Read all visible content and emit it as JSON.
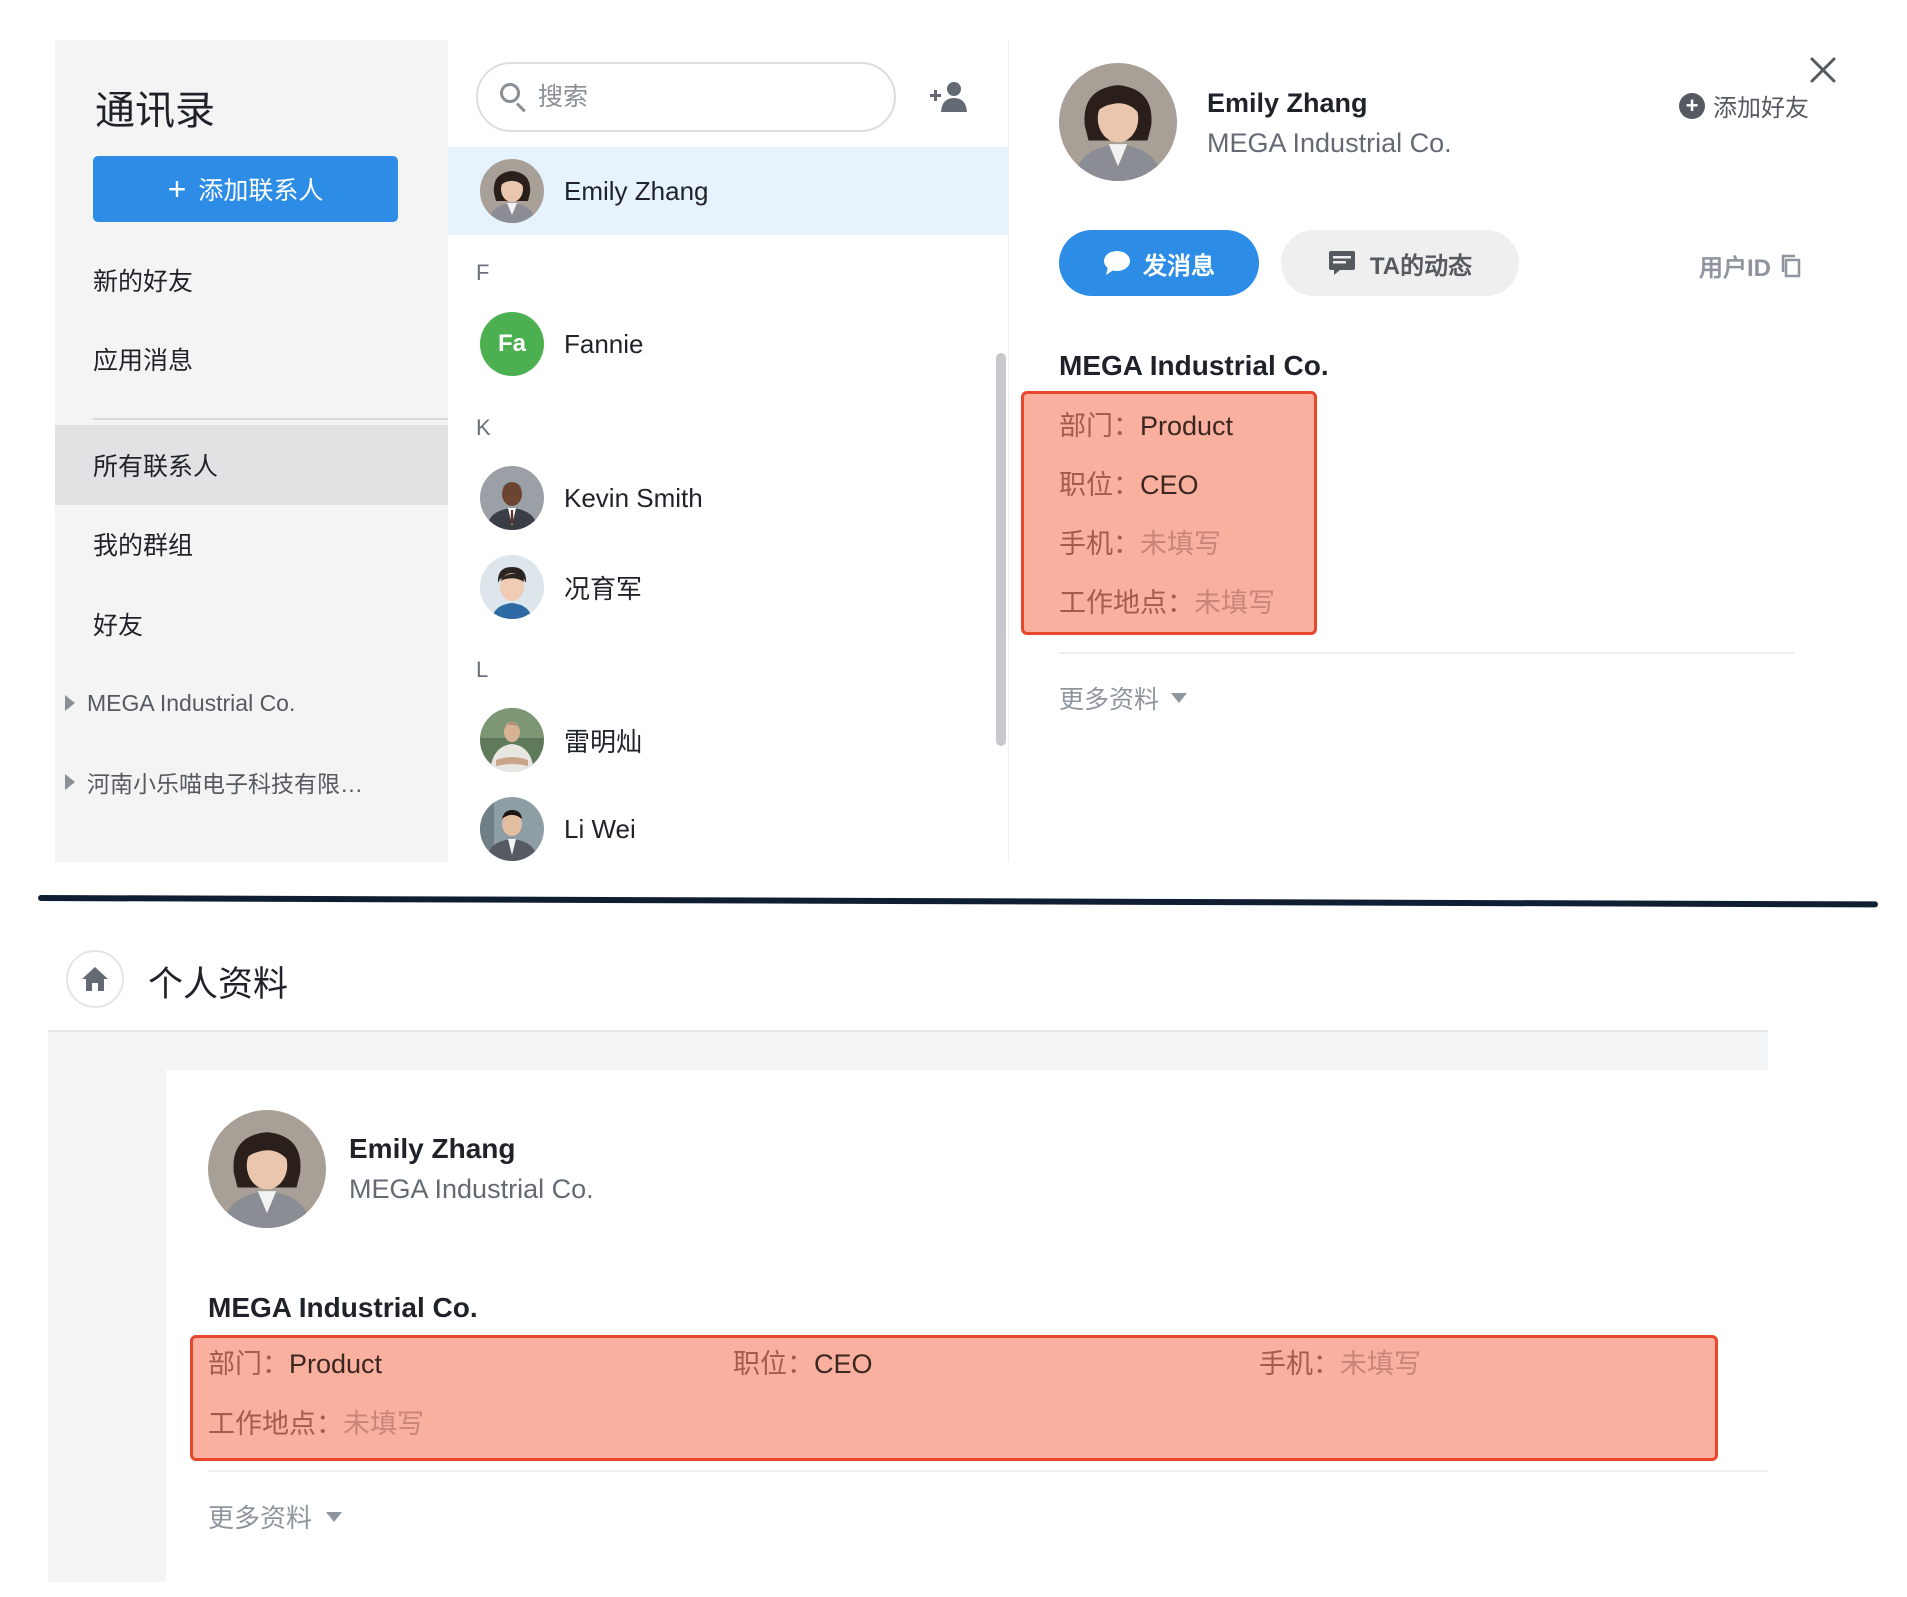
{
  "contacts_window": {
    "sidebar": {
      "title": "通讯录",
      "add_contact_label": "添加联系人",
      "items": [
        {
          "label": "新的好友"
        },
        {
          "label": "应用消息"
        },
        {
          "label": "所有联系人",
          "selected": true
        },
        {
          "label": "我的群组"
        },
        {
          "label": "好友"
        }
      ],
      "groups": [
        {
          "label": "MEGA Industrial Co."
        },
        {
          "label": "河南小乐喵电子科技有限…"
        }
      ]
    },
    "contact_list": {
      "search_placeholder": "搜索",
      "letters": {
        "f": "F",
        "k": "K",
        "l": "L"
      },
      "contacts": [
        {
          "name": "Emily Zhang",
          "selected": true
        },
        {
          "name": "Fannie",
          "initials": "Fa"
        },
        {
          "name": "Kevin Smith"
        },
        {
          "name": "况育军"
        },
        {
          "name": "雷明灿"
        },
        {
          "name": "Li Wei"
        }
      ]
    },
    "profile": {
      "name": "Emily Zhang",
      "company": "MEGA Industrial Co.",
      "add_friend_label": "添加好友",
      "send_message_label": "发消息",
      "moments_label": "TA的动态",
      "user_id_label": "用户ID",
      "org_name": "MEGA Industrial Co.",
      "fields": [
        {
          "label": "部门：",
          "value": "Product",
          "empty": false
        },
        {
          "label": "职位：",
          "value": "CEO",
          "empty": false
        },
        {
          "label": "手机：",
          "value": "未填写",
          "empty": true
        },
        {
          "label": "工作地点：",
          "value": "未填写",
          "empty": true
        }
      ],
      "more_info_label": "更多资料"
    }
  },
  "profile_page": {
    "title": "个人资料",
    "name": "Emily Zhang",
    "company": "MEGA Industrial Co.",
    "org_name": "MEGA Industrial Co.",
    "fields": [
      {
        "label": "部门：",
        "value": "Product"
      },
      {
        "label": "职位：",
        "value": "CEO"
      },
      {
        "label": "手机：",
        "value": "未填写"
      },
      {
        "label": "工作地点：",
        "value": "未填写"
      }
    ],
    "more_info_label": "更多资料"
  },
  "colors": {
    "accent": "#2c8ce6",
    "highlight_fill": "#f9b09e",
    "highlight_border": "#e8462d",
    "selected_row": "#e6f2fc",
    "fannie_avatar": "#4caf50"
  },
  "icons": {
    "search": "search-icon",
    "add_user": "add-user-icon",
    "close": "close-icon",
    "add_friend": "plus-circle-icon",
    "message": "chat-bubble-icon",
    "moments": "comment-icon",
    "copy": "copy-icon",
    "home": "home-icon"
  }
}
